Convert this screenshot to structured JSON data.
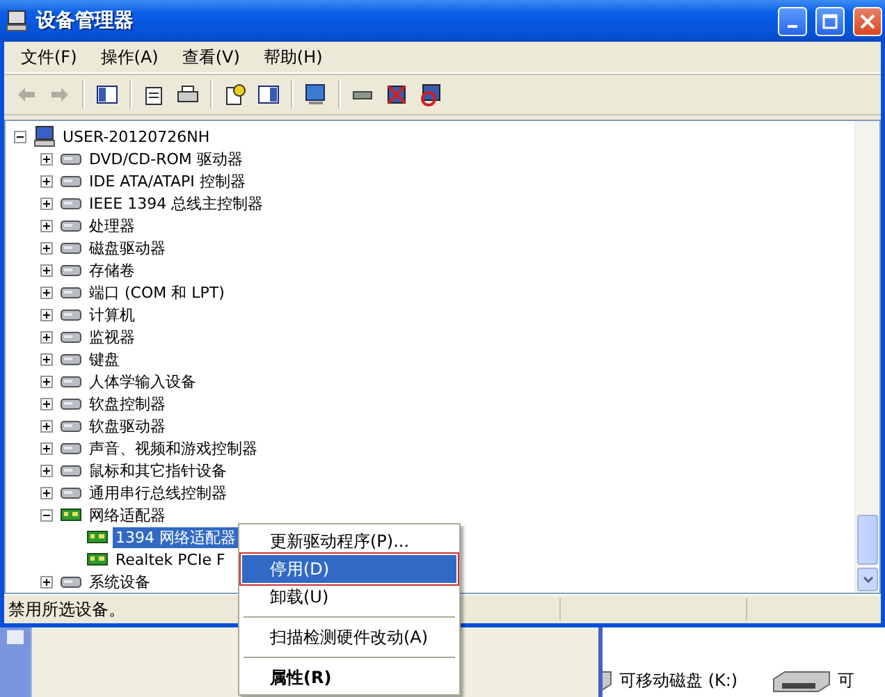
{
  "window": {
    "title": "设备管理器"
  },
  "menu": [
    "文件(F)",
    "操作(A)",
    "查看(V)",
    "帮助(H)"
  ],
  "navigation": [
    {
      "disabled": true
    },
    {
      "disabled": true
    }
  ],
  "tree": {
    "label": "USER-20120726NH",
    "expanded": true,
    "selected": false,
    "children": [
      {
        "label": "DVD/CD-ROM 驱动器",
        "expanded": false,
        "selected": false
      },
      {
        "label": "IDE ATA/ATAPI 控制器",
        "expanded": false,
        "selected": false
      },
      {
        "label": "IEEE 1394 总线主控制器",
        "expanded": false,
        "selected": false
      },
      {
        "label": "处理器",
        "expanded": false,
        "selected": false
      },
      {
        "label": "磁盘驱动器",
        "expanded": false,
        "selected": false
      },
      {
        "label": "存储卷",
        "expanded": false,
        "selected": false
      },
      {
        "label": "端口 (COM 和 LPT)",
        "expanded": false,
        "selected": false
      },
      {
        "label": "计算机",
        "expanded": false,
        "selected": false
      },
      {
        "label": "监视器",
        "expanded": false,
        "selected": false
      },
      {
        "label": "键盘",
        "expanded": false,
        "selected": false
      },
      {
        "label": "人体学输入设备",
        "expanded": false,
        "selected": false
      },
      {
        "label": "软盘控制器",
        "expanded": false,
        "selected": false
      },
      {
        "label": "软盘驱动器",
        "expanded": false,
        "selected": false
      },
      {
        "label": "声音、视频和游戏控制器",
        "expanded": false,
        "selected": false
      },
      {
        "label": "鼠标和其它指针设备",
        "expanded": false,
        "selected": false
      },
      {
        "label": "通用串行总线控制器",
        "expanded": false,
        "selected": false
      },
      {
        "label": "网络适配器",
        "expanded": true,
        "selected": false,
        "children": [
          {
            "label": "1394 网络适配器",
            "selected": true
          },
          {
            "label": "Realtek PCIe F",
            "selected": false
          }
        ]
      },
      {
        "label": "系统设备",
        "expanded": false,
        "selected": false
      }
    ]
  },
  "status_bar": "禁用所选设备。",
  "context_menu": [
    {
      "kind": "item",
      "label": "更新驱动程序(P)...",
      "selected": false,
      "default": false
    },
    {
      "kind": "item",
      "label": "停用(D)",
      "selected": true,
      "default": false
    },
    {
      "kind": "item",
      "label": "卸载(U)",
      "selected": false,
      "default": false
    },
    {
      "kind": "separator"
    },
    {
      "kind": "item",
      "label": "扫描检测硬件改动(A)",
      "selected": false,
      "default": false
    },
    {
      "kind": "separator"
    },
    {
      "kind": "item",
      "label": "属性(R)",
      "selected": false,
      "default": true
    }
  ],
  "background": {
    "items": [
      {
        "label": "可移动磁盘 (K:)"
      },
      {
        "label": "可"
      }
    ]
  }
}
